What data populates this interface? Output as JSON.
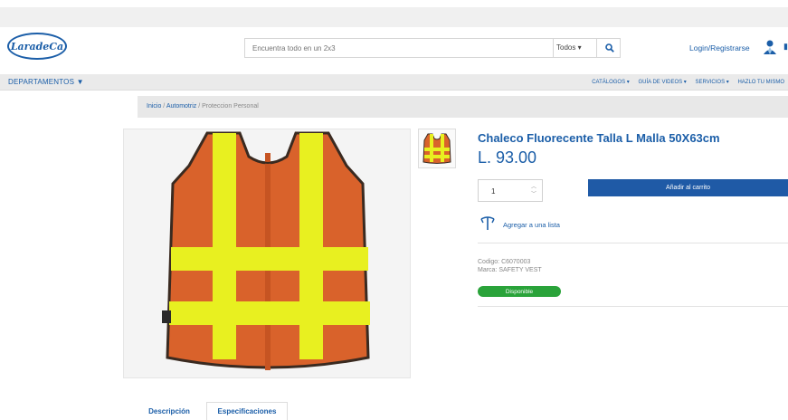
{
  "header": {
    "logo_text": "LaradeCa",
    "search_placeholder": "Encuentra todo en un 2x3",
    "search_category": "Todos",
    "login_label": "Login/Registrarse"
  },
  "navbar": {
    "departments_label": "DEPARTAMENTOS",
    "menu": [
      "CATÁLOGOS",
      "GUÍA DE VIDEOS",
      "SERVICIOS",
      "HAZLO TU MISMO"
    ]
  },
  "breadcrumb": {
    "items": [
      "Inicio",
      "Automotriz",
      "Proteccion Personal"
    ],
    "separator": "/"
  },
  "product": {
    "title": "Chaleco Fluorecente Talla L Malla 50X63cm",
    "price": "L. 93.00",
    "quantity": "1",
    "add_to_cart_label": "Añadir al carrito",
    "add_to_list_label": "Agregar a una lista",
    "code_line": "Codigo: C6070003",
    "brand_line": "Marca: SAFETY VEST",
    "availability": "Disponible"
  },
  "tabs": [
    "Descripción",
    "Especificaciones"
  ],
  "colors": {
    "brand_blue": "#1b5ea8",
    "button_blue": "#1f5aa6",
    "available_green": "#2aa33a",
    "vest_orange": "#d9622b",
    "reflective_yellow": "#e8f020"
  }
}
